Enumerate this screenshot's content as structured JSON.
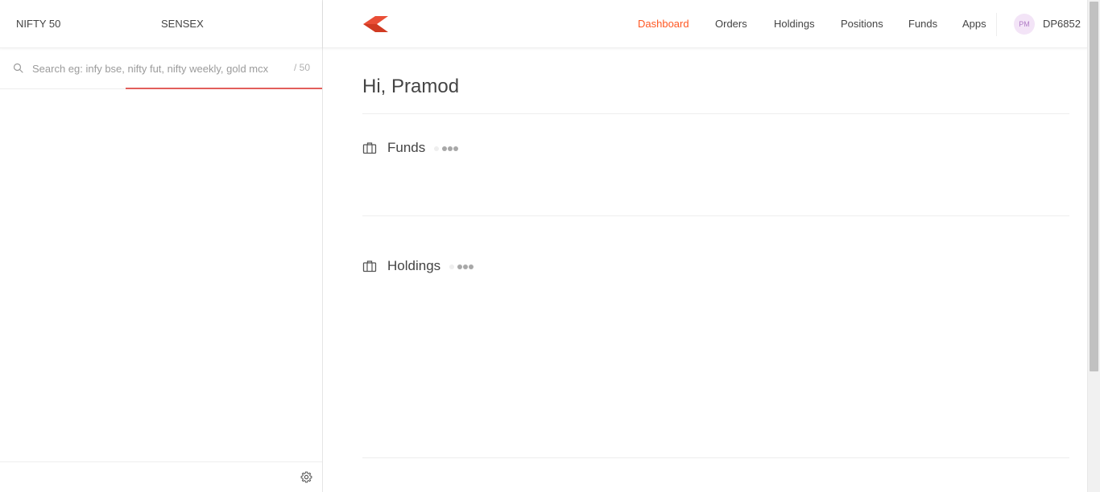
{
  "indices": [
    {
      "label": "NIFTY 50"
    },
    {
      "label": "SENSEX"
    }
  ],
  "search": {
    "placeholder": "Search eg: infy bse, nifty fut, nifty weekly, gold mcx",
    "value": "",
    "count": "/ 50"
  },
  "nav": {
    "items": [
      {
        "label": "Dashboard",
        "active": true
      },
      {
        "label": "Orders"
      },
      {
        "label": "Holdings"
      },
      {
        "label": "Positions"
      },
      {
        "label": "Funds"
      },
      {
        "label": "Apps"
      }
    ],
    "user": {
      "initials": "PM",
      "id": "DP6852"
    }
  },
  "main": {
    "greeting": "Hi, Pramod",
    "sections": [
      {
        "label": "Funds",
        "icon": "briefcase-icon"
      },
      {
        "label": "Holdings",
        "icon": "briefcase-icon"
      }
    ]
  },
  "colors": {
    "accent": "#ff5722",
    "search_underline": "#e25f5b",
    "logo": "#e94e36",
    "avatar_bg": "#f3e4f7",
    "avatar_text": "#b07cc6"
  },
  "icons": {
    "logo": "kite-logo-icon",
    "search": "search-icon",
    "settings": "gear-icon"
  }
}
